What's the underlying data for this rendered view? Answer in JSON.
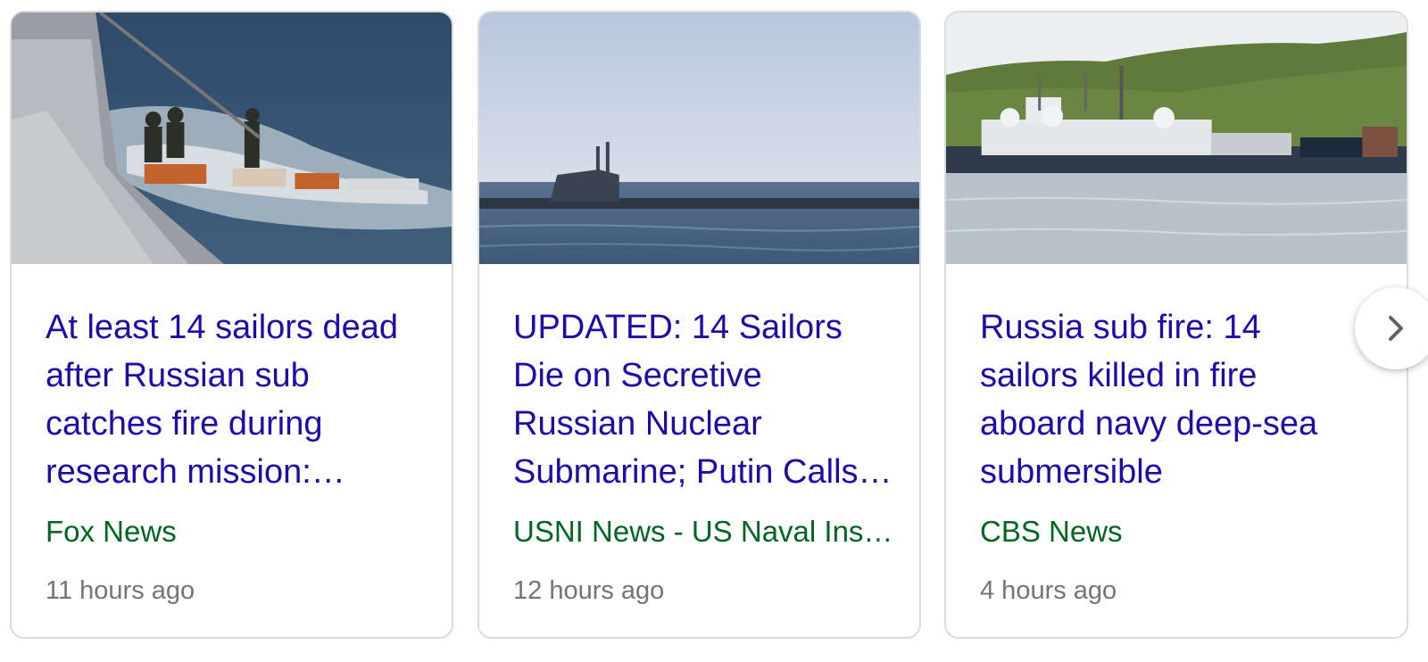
{
  "cards": [
    {
      "headline_lines": [
        "At least 14 sailors dead",
        "after Russian sub",
        "catches fire during",
        "research mission:…"
      ],
      "source": "Fox News",
      "time": "11 hours ago"
    },
    {
      "headline_lines": [
        "UPDATED: 14 Sailors",
        "Die on Secretive",
        "Russian Nuclear",
        "Submarine; Putin Calls…"
      ],
      "source": "USNI News - US Naval Ins…",
      "time": "12 hours ago"
    },
    {
      "headline_lines": [
        "Russia sub fire: 14",
        "sailors killed in fire",
        "aboard navy deep-sea",
        "submersible"
      ],
      "source": "CBS News",
      "time": "4 hours ago"
    }
  ],
  "next_button": {
    "icon": "chevron-right-icon"
  },
  "colors": {
    "headline": "#1a0dab",
    "source": "#006621",
    "time": "#70757a",
    "border": "#dadce0"
  }
}
